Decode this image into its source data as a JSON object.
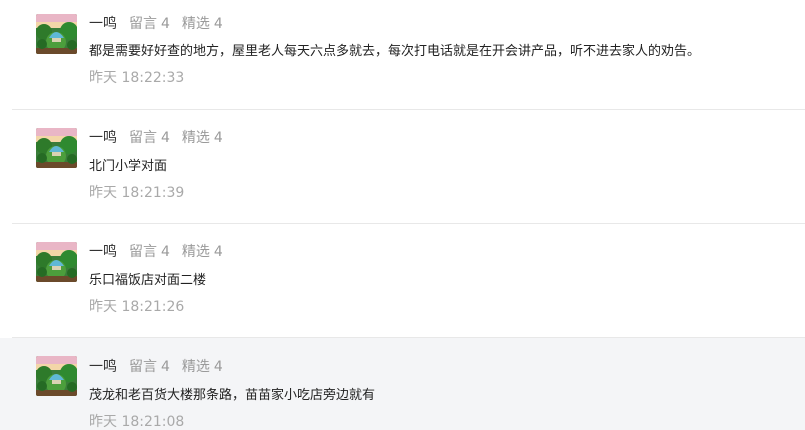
{
  "comments": [
    {
      "user": {
        "name": "一鸣",
        "avatar": "user-avatar"
      },
      "comments_label": "留言",
      "comments_count": "4",
      "featured_label": "精选",
      "featured_count": "4",
      "content": "都是需要好好查的地方，屋里老人每天六点多就去，每次打电话就是在开会讲产品，听不进去家人的劝告。",
      "time": "昨天 18:22:33"
    },
    {
      "user": {
        "name": "一鸣",
        "avatar": "user-avatar"
      },
      "comments_label": "留言",
      "comments_count": "4",
      "featured_label": "精选",
      "featured_count": "4",
      "content": "北门小学对面",
      "time": "昨天 18:21:39"
    },
    {
      "user": {
        "name": "一鸣",
        "avatar": "user-avatar"
      },
      "comments_label": "留言",
      "comments_count": "4",
      "featured_label": "精选",
      "featured_count": "4",
      "content": "乐口福饭店对面二楼",
      "time": "昨天 18:21:26"
    },
    {
      "user": {
        "name": "一鸣",
        "avatar": "user-avatar"
      },
      "comments_label": "留言",
      "comments_count": "4",
      "featured_label": "精选",
      "featured_count": "4",
      "content": "茂龙和老百货大楼那条路，苗苗家小吃店旁边就有",
      "time": "昨天 18:21:08"
    }
  ],
  "colors": {
    "name": "#333333",
    "stat": "#9a9a9a",
    "time": "#a9a9a9",
    "hover_background": "#f4f5f7",
    "divider": "#e8e8e8"
  }
}
